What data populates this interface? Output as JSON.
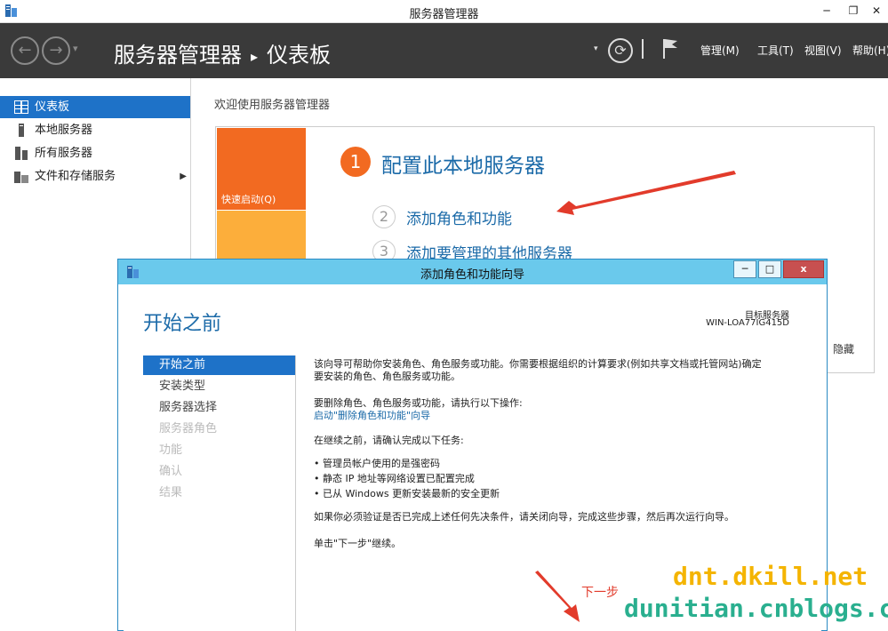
{
  "window": {
    "title": "服务器管理器",
    "minimize": "─",
    "restore": "❐",
    "close": "✕"
  },
  "header": {
    "back_icon": "←",
    "forward_icon": "→",
    "dropdown_icon": "▾",
    "breadcrumb_root": "服务器管理器",
    "breadcrumb_sep": "▸",
    "breadcrumb_current": "仪表板",
    "refresh_icon": "⟳",
    "menu": {
      "manage": "管理(M)",
      "tools": "工具(T)",
      "view": "视图(V)",
      "help": "帮助(H)"
    }
  },
  "sidebar": {
    "items": [
      {
        "label": "仪表板"
      },
      {
        "label": "本地服务器"
      },
      {
        "label": "所有服务器"
      },
      {
        "label": "文件和存储服务"
      }
    ],
    "expand_icon": "▶"
  },
  "dashboard": {
    "welcome": "欢迎使用服务器管理器",
    "quick_start": "快速启动(Q)",
    "step1_num": "1",
    "step1_label": "配置此本地服务器",
    "step2_num": "2",
    "step2_label": "添加角色和功能",
    "step3_num": "3",
    "step3_label": "添加要管理的其他服务器",
    "hide": "隐藏"
  },
  "wizard": {
    "title": "添加角色和功能向导",
    "minimize": "─",
    "maximize": "□",
    "close": "x",
    "heading": "开始之前",
    "target_label": "目标服务器",
    "target_value": "WIN-LOA77IG415D",
    "steps": [
      {
        "label": "开始之前",
        "state": "active"
      },
      {
        "label": "安装类型",
        "state": "normal"
      },
      {
        "label": "服务器选择",
        "state": "normal"
      },
      {
        "label": "服务器角色",
        "state": "disabled"
      },
      {
        "label": "功能",
        "state": "disabled"
      },
      {
        "label": "确认",
        "state": "disabled"
      },
      {
        "label": "结果",
        "state": "disabled"
      }
    ],
    "para1_line1": "该向导可帮助你安装角色、角色服务或功能。你需要根据组织的计算要求(例如共享文档或托管网站)确定",
    "para1_line2": "要安装的角色、角色服务或功能。",
    "para2": "要删除角色、角色服务或功能，请执行以下操作:",
    "para2_link": "启动\"删除角色和功能\"向导",
    "para3": "在继续之前，请确认完成以下任务:",
    "bullets": [
      "• 管理员帐户使用的是强密码",
      "• 静态 IP 地址等网络设置已配置完成",
      "• 已从 Windows 更新安装最新的安全更新"
    ],
    "para4": "如果你必须验证是否已完成上述任何先决条件，请关闭向导，完成这些步骤，然后再次运行向导。",
    "para5": "单击\"下一步\"继续。"
  },
  "annotation": {
    "next_hint": "下一步"
  },
  "watermark": {
    "line1": "dnt.dkill.net",
    "line2": "dunitian.cnblogs.com"
  },
  "colors": {
    "header_bg": "#3a3a3a",
    "accent": "#1e72c8",
    "orange": "#f26a21",
    "yellow": "#fcae3b",
    "wizard_title": "#6ac9ec",
    "annotation_red": "#e23b2b"
  }
}
